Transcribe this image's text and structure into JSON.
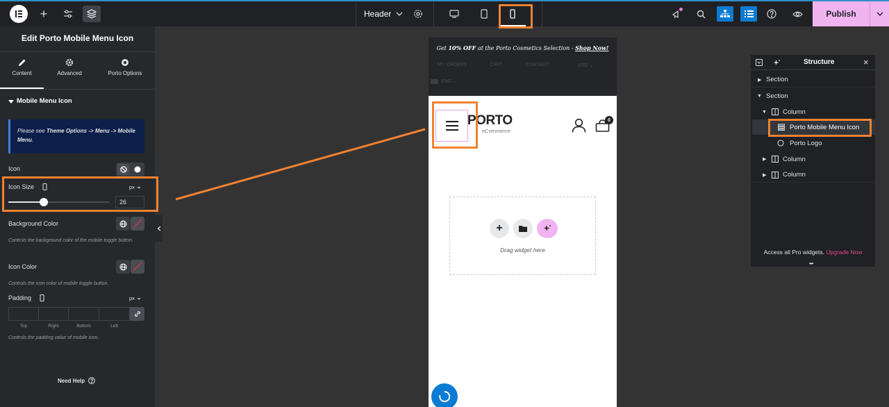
{
  "topbar": {
    "document_name": "Header",
    "publish_label": "Publish"
  },
  "panel": {
    "title": "Edit Porto Mobile Menu Icon",
    "tabs": [
      {
        "label": "Content",
        "icon": "pencil-icon"
      },
      {
        "label": "Advanced",
        "icon": "gear-icon"
      },
      {
        "label": "Porto Options",
        "icon": "circle-icon"
      }
    ],
    "section_title": "Mobile Menu Icon",
    "notice_prefix": "Please see ",
    "notice_bold": "Theme Options -> Menu -> Mobile Menu",
    "notice_suffix": ".",
    "icon_label": "Icon",
    "icon_size_label": "Icon Size",
    "icon_size_unit": "px",
    "icon_size_value": "26",
    "icon_size_fraction": 0.35,
    "bg_color_label": "Background Color",
    "bg_color_desc": "Controls the background color of the mobile toggle button.",
    "icon_color_label": "Icon Color",
    "icon_color_desc": "Controls the icon color of mobile toggle button.",
    "padding_label": "Padding",
    "padding_unit": "px",
    "padding_sides": [
      "Top",
      "Right",
      "Bottom",
      "Left"
    ],
    "padding_desc": "Controls the padding value of mobile icon.",
    "need_help": "Need Help"
  },
  "preview": {
    "promo_prefix": "Get ",
    "promo_bold": "10% OFF",
    "promo_mid": " at the Porto Cosmetics Selection - ",
    "promo_link": "Shop Now!",
    "nav_links": [
      "MY ORDERS",
      "CART",
      "CONTACT"
    ],
    "currency": "USD",
    "language": "ENG",
    "logo_text": "PORTO",
    "logo_sub": "eCommerce",
    "cart_count": "0",
    "drag_text": "Drag widget here"
  },
  "structure": {
    "title": "Structure",
    "items": [
      {
        "label": "Section"
      },
      {
        "label": "Section"
      },
      {
        "label": "Column"
      },
      {
        "label": "Porto Mobile Menu Icon"
      },
      {
        "label": "Porto Logo"
      },
      {
        "label": "Column"
      },
      {
        "label": "Column"
      }
    ],
    "footer_text": "Access all Pro widgets.",
    "footer_link": "Upgrade Now"
  },
  "colors": {
    "accent_orange": "#f08232",
    "publish_bg": "#f0b4f0",
    "link_pink": "#e2498a",
    "active_blue": "#0c7bd4",
    "notice_bg": "#0c1f4a"
  }
}
